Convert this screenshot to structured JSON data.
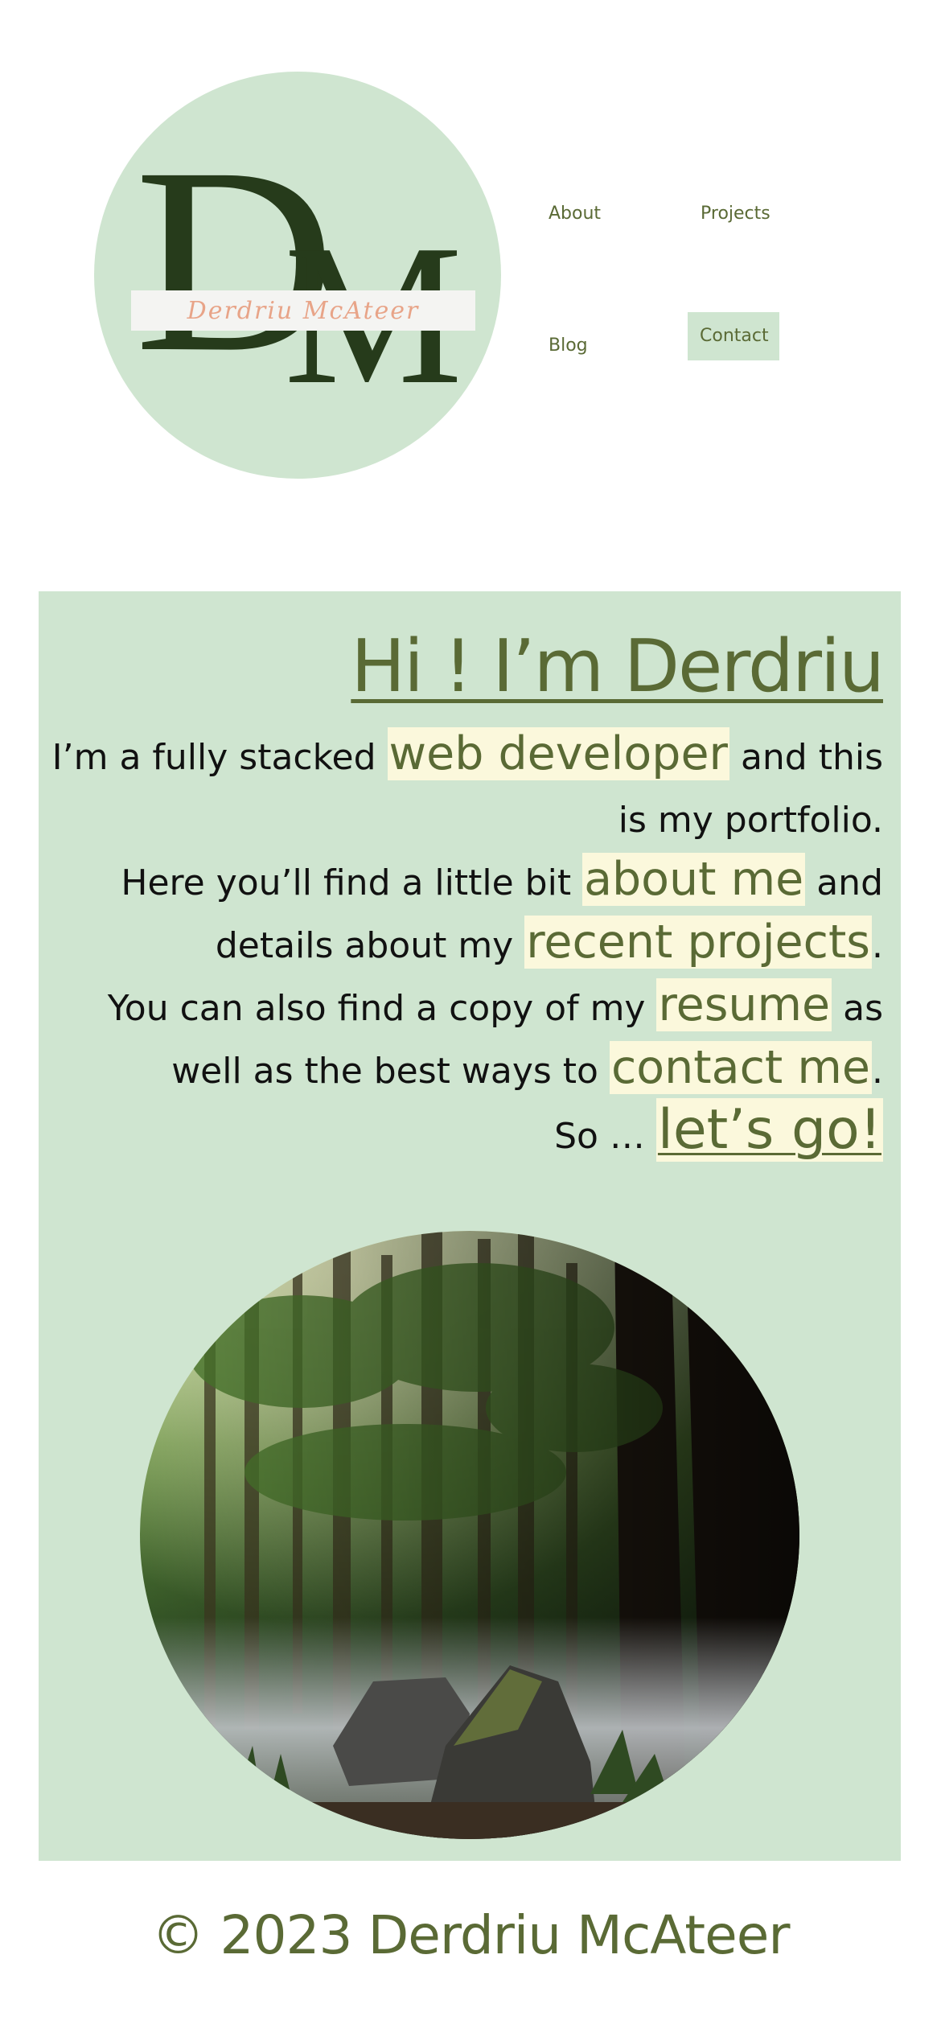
{
  "logo": {
    "letter_d": "D",
    "letter_m": "M",
    "script_name": "Derdriu McAteer"
  },
  "nav": {
    "about": "About",
    "projects": "Projects",
    "blog": "Blog",
    "contact": "Contact"
  },
  "hero": {
    "title": "Hi ! I’m Derdriu",
    "line1_a": "I’m a fully stacked ",
    "line1_link": "web developer",
    "line1_b": " and this",
    "line2": "is my portfolio.",
    "line3_a": "Here you’ll find a little bit ",
    "line3_link": "about me",
    "line3_b": " and",
    "line4_a": "details about my ",
    "line4_link": "recent projects",
    "line4_b": ".",
    "line5_a": "You can also find a copy of my ",
    "line5_link": "resume",
    "line5_b": " as",
    "line6_a": "well as the best ways to ",
    "line6_link": "contact me",
    "line6_b": ".",
    "line7_a": "So … ",
    "line7_link": "let’s go!"
  },
  "footer": {
    "copyright": "© 2023 Derdriu McAteer"
  },
  "colors": {
    "mint": "#cfe5d0",
    "olive": "#5a6a35",
    "highlight": "#fbf8dc",
    "logo_dark": "#263b1b",
    "logo_script": "#e8a488"
  }
}
